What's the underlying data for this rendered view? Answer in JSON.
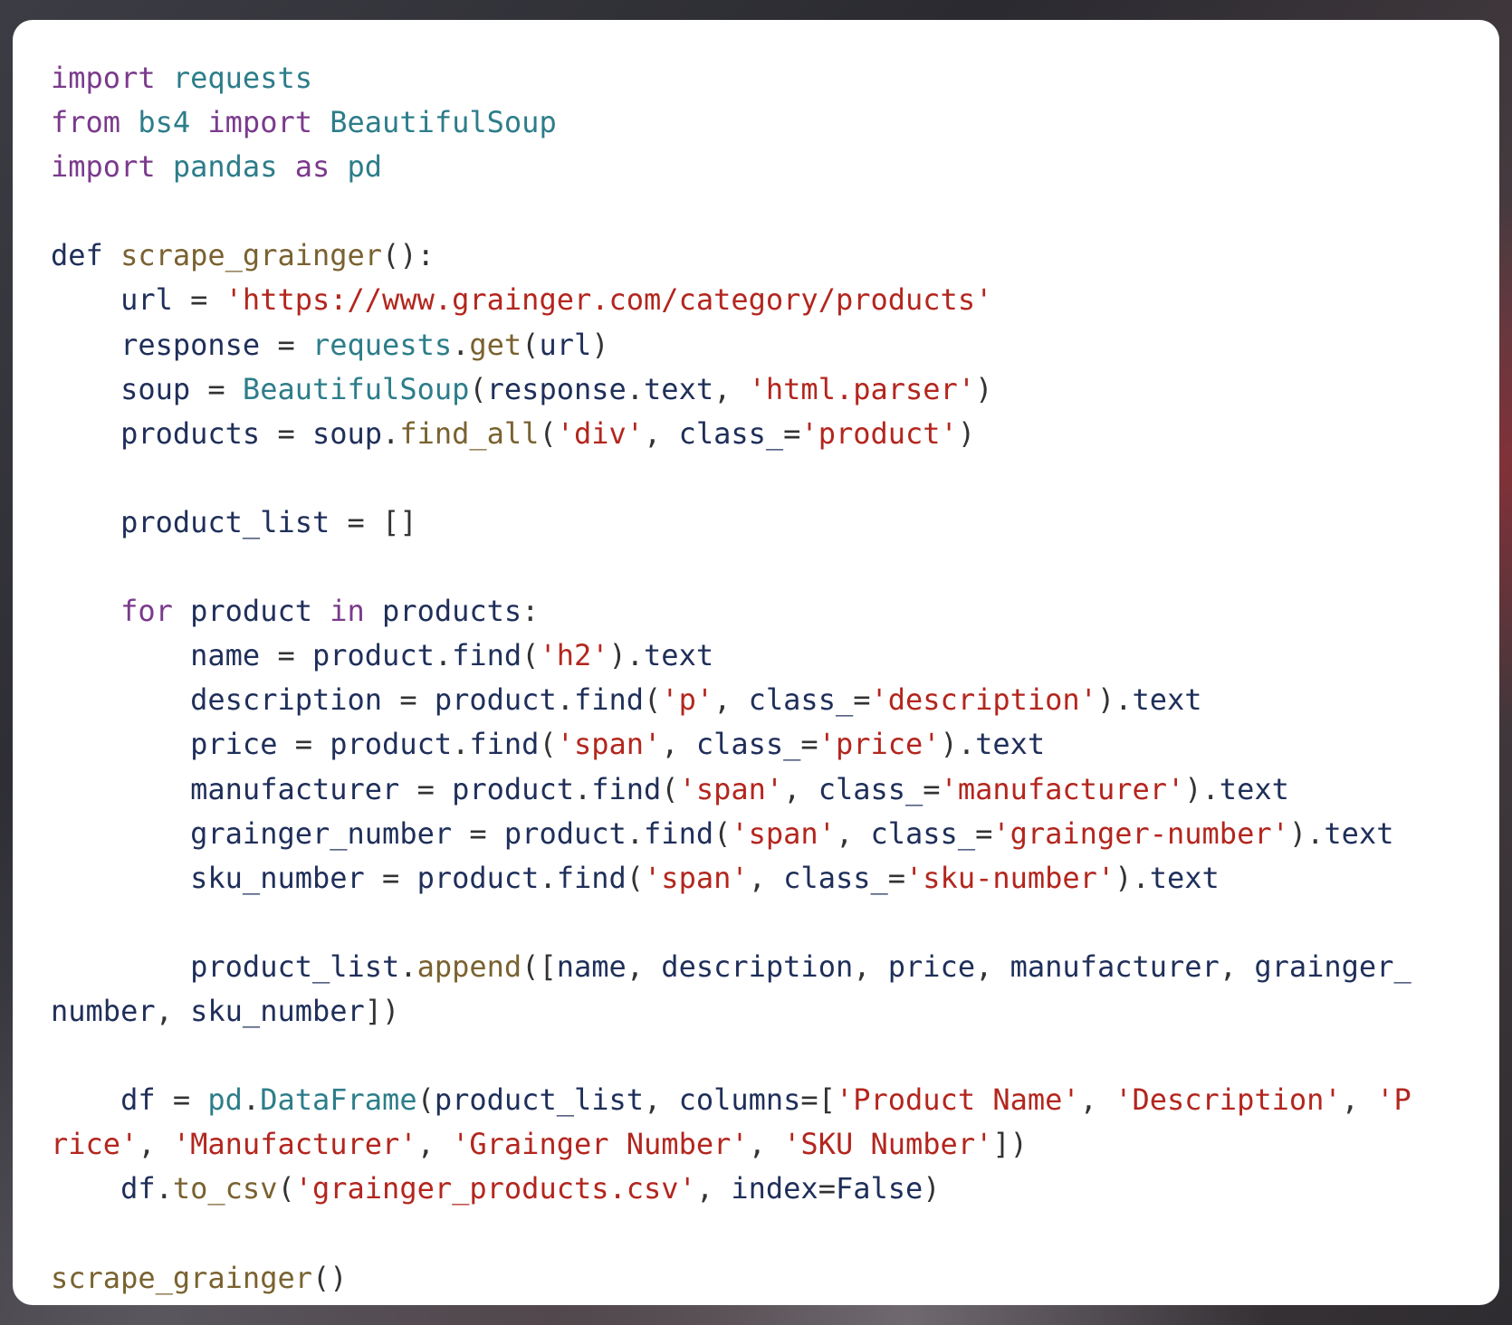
{
  "code": {
    "language": "python",
    "lines": [
      [
        {
          "t": "import",
          "c": "kw"
        },
        {
          "t": " ",
          "c": "pun"
        },
        {
          "t": "requests",
          "c": "mod"
        }
      ],
      [
        {
          "t": "from",
          "c": "kw"
        },
        {
          "t": " ",
          "c": "pun"
        },
        {
          "t": "bs4",
          "c": "mod"
        },
        {
          "t": " ",
          "c": "pun"
        },
        {
          "t": "import",
          "c": "kw"
        },
        {
          "t": " ",
          "c": "pun"
        },
        {
          "t": "BeautifulSoup",
          "c": "mod"
        }
      ],
      [
        {
          "t": "import",
          "c": "kw"
        },
        {
          "t": " ",
          "c": "pun"
        },
        {
          "t": "pandas",
          "c": "mod"
        },
        {
          "t": " ",
          "c": "pun"
        },
        {
          "t": "as",
          "c": "kw"
        },
        {
          "t": " ",
          "c": "pun"
        },
        {
          "t": "pd",
          "c": "mod"
        }
      ],
      [],
      [
        {
          "t": "def",
          "c": "kw2"
        },
        {
          "t": " ",
          "c": "pun"
        },
        {
          "t": "scrape_grainger",
          "c": "fn"
        },
        {
          "t": "():",
          "c": "pun"
        }
      ],
      [
        {
          "t": "    url",
          "c": "var"
        },
        {
          "t": " = ",
          "c": "pun"
        },
        {
          "t": "'https://www.grainger.com/category/products'",
          "c": "str"
        }
      ],
      [
        {
          "t": "    response",
          "c": "var"
        },
        {
          "t": " = ",
          "c": "pun"
        },
        {
          "t": "requests",
          "c": "mod"
        },
        {
          "t": ".",
          "c": "pun"
        },
        {
          "t": "get",
          "c": "fn"
        },
        {
          "t": "(",
          "c": "pun"
        },
        {
          "t": "url",
          "c": "var"
        },
        {
          "t": ")",
          "c": "pun"
        }
      ],
      [
        {
          "t": "    soup",
          "c": "var"
        },
        {
          "t": " = ",
          "c": "pun"
        },
        {
          "t": "BeautifulSoup",
          "c": "cls"
        },
        {
          "t": "(",
          "c": "pun"
        },
        {
          "t": "response",
          "c": "var"
        },
        {
          "t": ".",
          "c": "pun"
        },
        {
          "t": "text",
          "c": "var"
        },
        {
          "t": ", ",
          "c": "pun"
        },
        {
          "t": "'html.parser'",
          "c": "str"
        },
        {
          "t": ")",
          "c": "pun"
        }
      ],
      [
        {
          "t": "    products",
          "c": "var"
        },
        {
          "t": " = ",
          "c": "pun"
        },
        {
          "t": "soup",
          "c": "var"
        },
        {
          "t": ".",
          "c": "pun"
        },
        {
          "t": "find_all",
          "c": "fn"
        },
        {
          "t": "(",
          "c": "pun"
        },
        {
          "t": "'div'",
          "c": "str"
        },
        {
          "t": ", ",
          "c": "pun"
        },
        {
          "t": "class_",
          "c": "var"
        },
        {
          "t": "=",
          "c": "pun"
        },
        {
          "t": "'product'",
          "c": "str"
        },
        {
          "t": ")",
          "c": "pun"
        }
      ],
      [],
      [
        {
          "t": "    product_list",
          "c": "var"
        },
        {
          "t": " = ",
          "c": "pun"
        },
        {
          "t": "[]",
          "c": "pun"
        }
      ],
      [],
      [
        {
          "t": "    ",
          "c": "pun"
        },
        {
          "t": "for",
          "c": "kw"
        },
        {
          "t": " ",
          "c": "pun"
        },
        {
          "t": "product",
          "c": "var"
        },
        {
          "t": " ",
          "c": "pun"
        },
        {
          "t": "in",
          "c": "kw"
        },
        {
          "t": " ",
          "c": "pun"
        },
        {
          "t": "products",
          "c": "var"
        },
        {
          "t": ":",
          "c": "pun"
        }
      ],
      [
        {
          "t": "        name",
          "c": "var"
        },
        {
          "t": " = ",
          "c": "pun"
        },
        {
          "t": "product",
          "c": "var"
        },
        {
          "t": ".",
          "c": "pun"
        },
        {
          "t": "find",
          "c": "var"
        },
        {
          "t": "(",
          "c": "pun"
        },
        {
          "t": "'h2'",
          "c": "str"
        },
        {
          "t": ").",
          "c": "pun"
        },
        {
          "t": "text",
          "c": "var"
        }
      ],
      [
        {
          "t": "        description",
          "c": "var"
        },
        {
          "t": " = ",
          "c": "pun"
        },
        {
          "t": "product",
          "c": "var"
        },
        {
          "t": ".",
          "c": "pun"
        },
        {
          "t": "find",
          "c": "var"
        },
        {
          "t": "(",
          "c": "pun"
        },
        {
          "t": "'p'",
          "c": "str"
        },
        {
          "t": ", ",
          "c": "pun"
        },
        {
          "t": "class_",
          "c": "var"
        },
        {
          "t": "=",
          "c": "pun"
        },
        {
          "t": "'description'",
          "c": "str"
        },
        {
          "t": ").",
          "c": "pun"
        },
        {
          "t": "text",
          "c": "var"
        }
      ],
      [
        {
          "t": "        price",
          "c": "var"
        },
        {
          "t": " = ",
          "c": "pun"
        },
        {
          "t": "product",
          "c": "var"
        },
        {
          "t": ".",
          "c": "pun"
        },
        {
          "t": "find",
          "c": "var"
        },
        {
          "t": "(",
          "c": "pun"
        },
        {
          "t": "'span'",
          "c": "str"
        },
        {
          "t": ", ",
          "c": "pun"
        },
        {
          "t": "class_",
          "c": "var"
        },
        {
          "t": "=",
          "c": "pun"
        },
        {
          "t": "'price'",
          "c": "str"
        },
        {
          "t": ").",
          "c": "pun"
        },
        {
          "t": "text",
          "c": "var"
        }
      ],
      [
        {
          "t": "        manufacturer",
          "c": "var"
        },
        {
          "t": " = ",
          "c": "pun"
        },
        {
          "t": "product",
          "c": "var"
        },
        {
          "t": ".",
          "c": "pun"
        },
        {
          "t": "find",
          "c": "var"
        },
        {
          "t": "(",
          "c": "pun"
        },
        {
          "t": "'span'",
          "c": "str"
        },
        {
          "t": ", ",
          "c": "pun"
        },
        {
          "t": "class_",
          "c": "var"
        },
        {
          "t": "=",
          "c": "pun"
        },
        {
          "t": "'manufacturer'",
          "c": "str"
        },
        {
          "t": ").",
          "c": "pun"
        },
        {
          "t": "text",
          "c": "var"
        }
      ],
      [
        {
          "t": "        grainger_number",
          "c": "var"
        },
        {
          "t": " = ",
          "c": "pun"
        },
        {
          "t": "product",
          "c": "var"
        },
        {
          "t": ".",
          "c": "pun"
        },
        {
          "t": "find",
          "c": "var"
        },
        {
          "t": "(",
          "c": "pun"
        },
        {
          "t": "'span'",
          "c": "str"
        },
        {
          "t": ", ",
          "c": "pun"
        },
        {
          "t": "class_",
          "c": "var"
        },
        {
          "t": "=",
          "c": "pun"
        },
        {
          "t": "'grainger-number'",
          "c": "str"
        },
        {
          "t": ").",
          "c": "pun"
        },
        {
          "t": "text",
          "c": "var"
        }
      ],
      [
        {
          "t": "        sku_number",
          "c": "var"
        },
        {
          "t": " = ",
          "c": "pun"
        },
        {
          "t": "product",
          "c": "var"
        },
        {
          "t": ".",
          "c": "pun"
        },
        {
          "t": "find",
          "c": "var"
        },
        {
          "t": "(",
          "c": "pun"
        },
        {
          "t": "'span'",
          "c": "str"
        },
        {
          "t": ", ",
          "c": "pun"
        },
        {
          "t": "class_",
          "c": "var"
        },
        {
          "t": "=",
          "c": "pun"
        },
        {
          "t": "'sku-number'",
          "c": "str"
        },
        {
          "t": ").",
          "c": "pun"
        },
        {
          "t": "text",
          "c": "var"
        }
      ],
      [],
      [
        {
          "t": "        product_list",
          "c": "var"
        },
        {
          "t": ".",
          "c": "pun"
        },
        {
          "t": "append",
          "c": "fn"
        },
        {
          "t": "([",
          "c": "pun"
        },
        {
          "t": "name",
          "c": "var"
        },
        {
          "t": ", ",
          "c": "pun"
        },
        {
          "t": "description",
          "c": "var"
        },
        {
          "t": ", ",
          "c": "pun"
        },
        {
          "t": "price",
          "c": "var"
        },
        {
          "t": ", ",
          "c": "pun"
        },
        {
          "t": "manufacturer",
          "c": "var"
        },
        {
          "t": ", ",
          "c": "pun"
        },
        {
          "t": "grainger_",
          "c": "var"
        }
      ],
      [
        {
          "t": "number",
          "c": "var"
        },
        {
          "t": ", ",
          "c": "pun"
        },
        {
          "t": "sku_number",
          "c": "var"
        },
        {
          "t": "])",
          "c": "pun"
        }
      ],
      [],
      [
        {
          "t": "    df",
          "c": "var"
        },
        {
          "t": " = ",
          "c": "pun"
        },
        {
          "t": "pd",
          "c": "mod"
        },
        {
          "t": ".",
          "c": "pun"
        },
        {
          "t": "DataFrame",
          "c": "cls"
        },
        {
          "t": "(",
          "c": "pun"
        },
        {
          "t": "product_list",
          "c": "var"
        },
        {
          "t": ", ",
          "c": "pun"
        },
        {
          "t": "columns",
          "c": "var"
        },
        {
          "t": "=[",
          "c": "pun"
        },
        {
          "t": "'Product Name'",
          "c": "str"
        },
        {
          "t": ", ",
          "c": "pun"
        },
        {
          "t": "'Description'",
          "c": "str"
        },
        {
          "t": ", ",
          "c": "pun"
        },
        {
          "t": "'P",
          "c": "str"
        }
      ],
      [
        {
          "t": "rice'",
          "c": "str"
        },
        {
          "t": ", ",
          "c": "pun"
        },
        {
          "t": "'Manufacturer'",
          "c": "str"
        },
        {
          "t": ", ",
          "c": "pun"
        },
        {
          "t": "'Grainger Number'",
          "c": "str"
        },
        {
          "t": ", ",
          "c": "pun"
        },
        {
          "t": "'SKU Number'",
          "c": "str"
        },
        {
          "t": "])",
          "c": "pun"
        }
      ],
      [
        {
          "t": "    df",
          "c": "var"
        },
        {
          "t": ".",
          "c": "pun"
        },
        {
          "t": "to_csv",
          "c": "fn"
        },
        {
          "t": "(",
          "c": "pun"
        },
        {
          "t": "'grainger_products.csv'",
          "c": "str"
        },
        {
          "t": ", ",
          "c": "pun"
        },
        {
          "t": "index",
          "c": "var"
        },
        {
          "t": "=",
          "c": "pun"
        },
        {
          "t": "False",
          "c": "bool"
        },
        {
          "t": ")",
          "c": "pun"
        }
      ],
      [],
      [
        {
          "t": "scrape_grainger",
          "c": "fn"
        },
        {
          "t": "()",
          "c": "pun"
        }
      ]
    ]
  }
}
